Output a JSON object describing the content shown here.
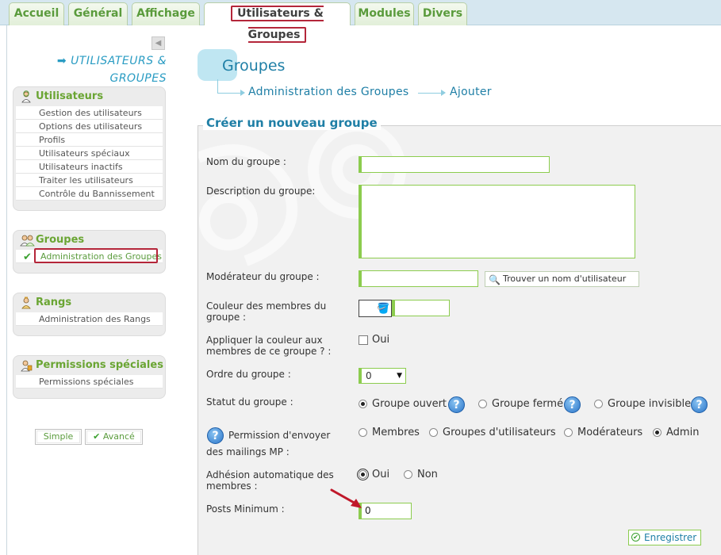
{
  "tabs": [
    {
      "label": "Accueil",
      "active": false
    },
    {
      "label": "Général",
      "active": false
    },
    {
      "label": "Affichage",
      "active": false
    },
    {
      "label": "Utilisateurs & Groupes",
      "active": true
    },
    {
      "label": "Modules",
      "active": false
    },
    {
      "label": "Divers",
      "active": false
    }
  ],
  "sidebar": {
    "heading_line1": "UTILISATEURS &",
    "heading_line2": "GROUPES",
    "users": {
      "title": "Utilisateurs",
      "items": [
        "Gestion des utilisateurs",
        "Options des utilisateurs",
        "Profils",
        "Utilisateurs spéciaux",
        "Utilisateurs inactifs",
        "Traiter les utilisateurs",
        "Contrôle du Bannissement"
      ]
    },
    "groups": {
      "title": "Groupes",
      "items": [
        "Administration des Groupes"
      ]
    },
    "ranks": {
      "title": "Rangs",
      "items": [
        "Administration des Rangs"
      ]
    },
    "perms": {
      "title": "Permissions spéciales",
      "items": [
        "Permissions spéciales"
      ]
    },
    "mode_simple": "Simple",
    "mode_advanced": "Avancé"
  },
  "main": {
    "title": "Groupes",
    "breadcrumb": [
      "Administration des Groupes",
      "Ajouter"
    ],
    "legend": "Créer un nouveau groupe",
    "form": {
      "name_label": "Nom du groupe :",
      "name_value": "",
      "desc_label": "Description du groupe:",
      "desc_value": "",
      "moderator_label": "Modérateur du groupe :",
      "moderator_value": "",
      "find_user_button": "Trouver un nom d'utilisateur",
      "color_label_line1": "Couleur des membres du",
      "color_label_line2": "groupe :",
      "color_value": "",
      "apply_color_label_line1": "Appliquer la couleur aux",
      "apply_color_label_line2": "membres de ce groupe ? :",
      "apply_color_option": "Oui",
      "order_label": "Ordre du groupe :",
      "order_value": "0",
      "status_label": "Statut du groupe :",
      "status_options": [
        "Groupe ouvert",
        "Groupe fermé",
        "Groupe invisible"
      ],
      "status_selected": "Groupe ouvert",
      "mailing_label_line1": "Permission d'envoyer",
      "mailing_label_line2": "des mailings MP :",
      "mailing_options": [
        "Membres",
        "Groupes d'utilisateurs",
        "Modérateurs",
        "Admin"
      ],
      "mailing_selected": "Admin",
      "auto_join_label_line1": "Adhésion automatique des",
      "auto_join_label_line2": "membres :",
      "auto_join_options": [
        "Oui",
        "Non"
      ],
      "auto_join_selected": "Oui",
      "min_posts_label": "Posts Minimum :",
      "min_posts_value": "0",
      "save_button": "Enregistrer"
    }
  },
  "colors": {
    "accent_blue": "#1f7fa6",
    "accent_green": "#8ccc4e",
    "highlight_red": "#b4263a"
  }
}
